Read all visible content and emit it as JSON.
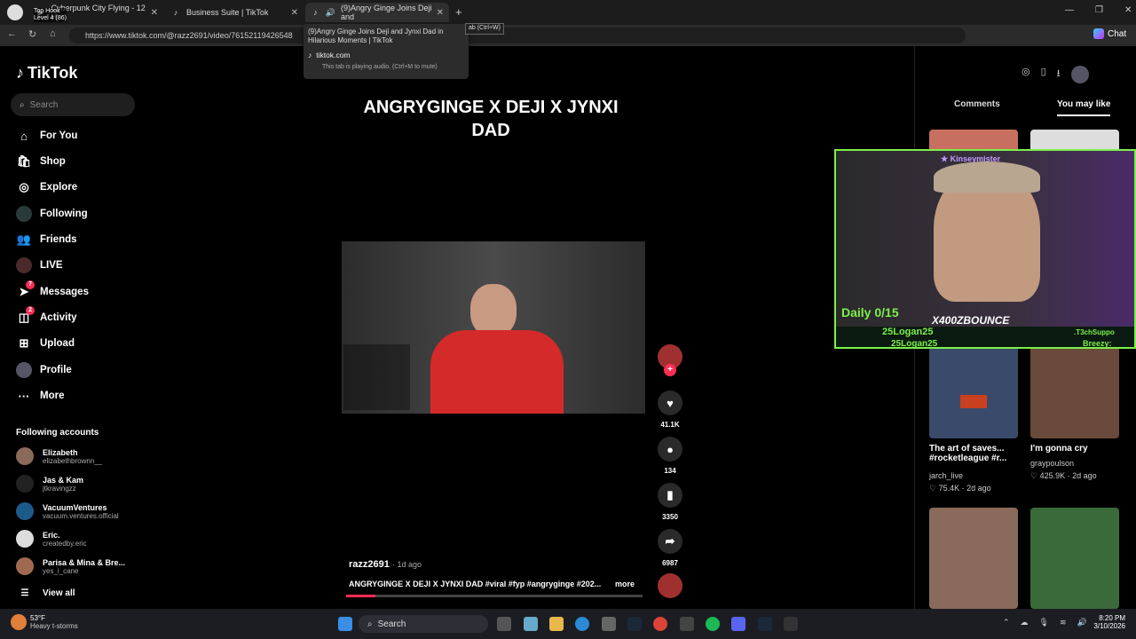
{
  "browser": {
    "tabs": [
      {
        "title": "Cyberpunk City Flying - 12 H",
        "overlay_title": "Top Hook",
        "overlay_sub": "Level 4 (86)"
      },
      {
        "title": "Business Suite | TikTok"
      },
      {
        "title": "(9)Angry Ginge Joins Deji and"
      }
    ],
    "url": "https://www.tiktok.com/@razz2691/video/76152119426548",
    "chat_label": "Chat",
    "close_tab_hint": "ab (Ctrl+W)",
    "hover_card": {
      "title": "(9)Angry Ginge Joins Deji and Jynxi Dad in Hilarious Moments | TikTok",
      "domain": "tiktok.com",
      "note": "This tab is playing audio. (Ctrl+M to mute)"
    }
  },
  "sidebar": {
    "logo": "TikTok",
    "search_placeholder": "Search",
    "nav": [
      {
        "label": "For You",
        "icon": "home-icon"
      },
      {
        "label": "Shop",
        "icon": "shop-icon"
      },
      {
        "label": "Explore",
        "icon": "compass-icon"
      },
      {
        "label": "Following",
        "icon": "following-icon"
      },
      {
        "label": "Friends",
        "icon": "friends-icon"
      },
      {
        "label": "LIVE",
        "icon": "live-icon"
      },
      {
        "label": "Messages",
        "icon": "messages-icon",
        "badge": "7"
      },
      {
        "label": "Activity",
        "icon": "activity-icon",
        "badge": "2"
      },
      {
        "label": "Upload",
        "icon": "upload-icon"
      },
      {
        "label": "Profile",
        "icon": "profile-icon"
      },
      {
        "label": "More",
        "icon": "more-icon"
      }
    ],
    "following_heading": "Following accounts",
    "accounts": [
      {
        "name": "Elizabeth",
        "handle": "elizabethbrownn__"
      },
      {
        "name": "Jas & Kam",
        "handle": "jtkravingzz"
      },
      {
        "name": "VacuumVentures",
        "handle": "vacuum.ventures.official"
      },
      {
        "name": "Eric.",
        "handle": "createdby.eric"
      },
      {
        "name": "Parisa & Mina & Bre...",
        "handle": "yes_i_cane"
      }
    ],
    "view_all": "View all"
  },
  "video": {
    "title": "ANGRYGINGE X DEJI X JYNXI DAD",
    "likes": "41.1K",
    "comments": "134",
    "saves": "3350",
    "shares": "6987",
    "author": "razz2691",
    "age": "1d ago",
    "caption": "ANGRYGINGE X DEJI X JYNXI DAD #viral #fyp #angryginge #202...",
    "more": "more",
    "progress": 0.1
  },
  "right_panel": {
    "tabs": [
      "Comments",
      "You may like"
    ],
    "active_tab": "You may like",
    "cards": [
      {
        "title": "The art of saves... #rocketleague #r...",
        "author": "jarch_live",
        "likes": "75.4K",
        "age": "2d ago"
      },
      {
        "title": "I'm gonna cry",
        "author": "graypoulson",
        "likes": "425.9K",
        "age": "2d ago"
      }
    ]
  },
  "stream_overlay": {
    "name_tag": "Kinseymister",
    "daily": "Daily 0/15",
    "streamer": "X400ZBOUNCE",
    "user1": "25Logan25",
    "user2": "25Logan25",
    "user3": ".T3chSuppo",
    "user4": "Breezy:"
  },
  "taskbar": {
    "temp": "53°F",
    "weather": "Heavy t-storms",
    "search": "Search",
    "time": "8:20 PM",
    "date": "3/10/2026"
  },
  "colors": {
    "accent": "#fe2c55",
    "overlay_green": "#7cf04a"
  }
}
